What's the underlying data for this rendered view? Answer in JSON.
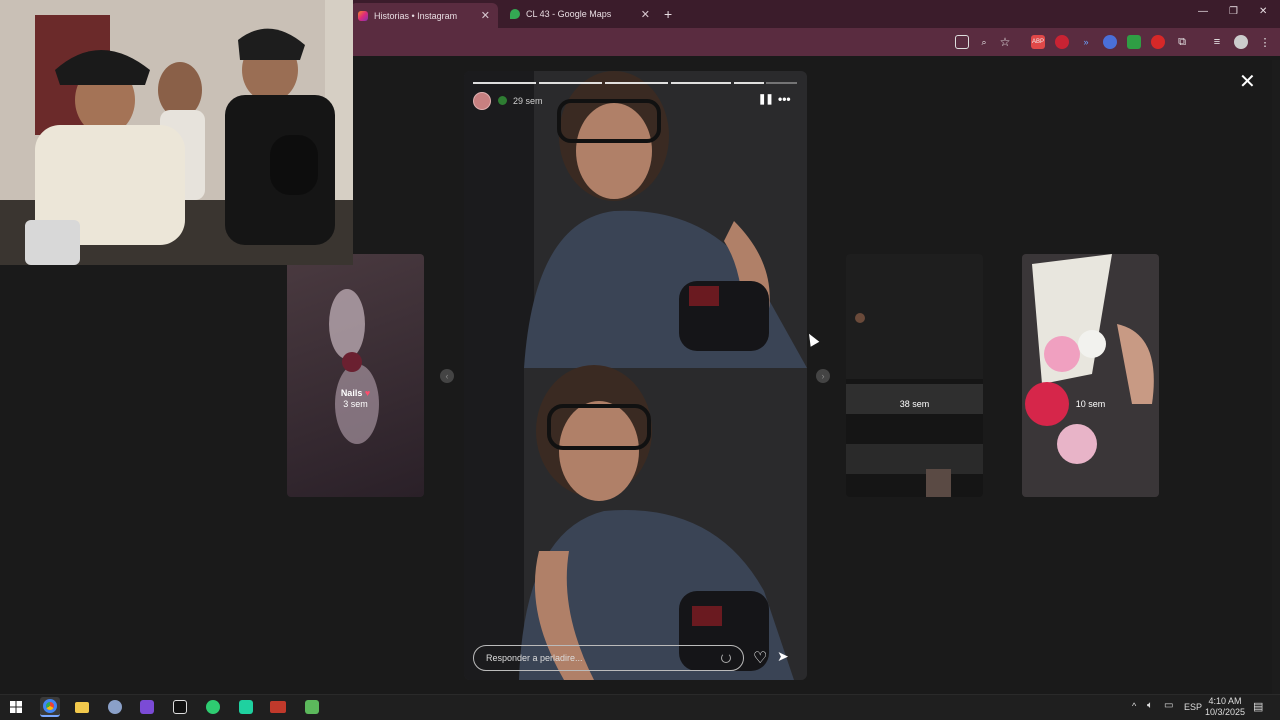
{
  "browser": {
    "tabs": [
      {
        "title": "Historias • Instagram"
      },
      {
        "title": "CL 43 - Google Maps"
      }
    ],
    "new_tab": "+",
    "window_controls": {
      "minimize": "—",
      "restore": "❐",
      "close": "✕"
    }
  },
  "stories": {
    "prev_left": {
      "title": "Nails",
      "age": "3 sem"
    },
    "current": {
      "age": "29 sem",
      "reply_placeholder": "Responder a perladire..."
    },
    "next_1": {
      "age": "38 sem"
    },
    "next_2": {
      "age": "10 sem"
    },
    "close_label": "✕"
  },
  "taskbar": {
    "language": "ESP",
    "time": "4:10 AM",
    "date": "10/3/2025"
  },
  "colors": {
    "chrome_tab_bar": "#3b1c2b",
    "chrome_toolbar": "#5a2c40",
    "page_bg": "#1a1a1a"
  }
}
